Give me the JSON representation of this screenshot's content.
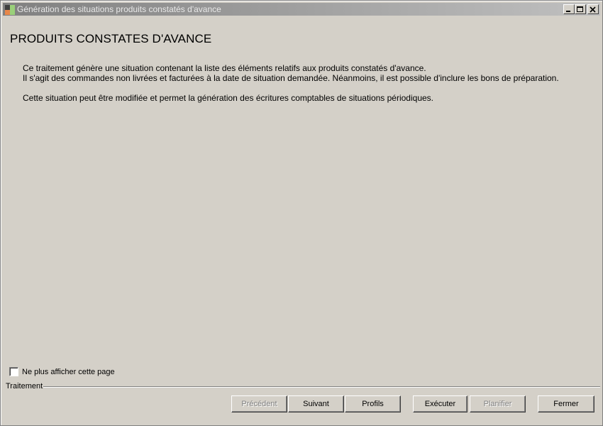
{
  "window": {
    "title": "Génération des situations produits constatés d'avance"
  },
  "page": {
    "title": "PRODUITS CONSTATES D'AVANCE",
    "description": [
      "Ce traitement génère une situation contenant la liste des éléments relatifs aux produits constatés d'avance.",
      "Il s'agit des commandes non livrées et facturées à la date de situation demandée. Néanmoins, il est possible d'inclure les bons de préparation.",
      "Cette situation peut être modifiée et permet la génération des écritures comptables de situations périodiques."
    ]
  },
  "options": {
    "dont_show_label": "Ne plus afficher cette page",
    "dont_show_checked": false
  },
  "group": {
    "label": "Traitement"
  },
  "buttons": {
    "previous": {
      "label": "Précédent",
      "enabled": false
    },
    "next": {
      "label": "Suivant",
      "enabled": true
    },
    "profiles": {
      "label": "Profils",
      "enabled": true
    },
    "execute": {
      "label": "Exécuter",
      "enabled": true
    },
    "schedule": {
      "label": "Planifier",
      "enabled": false
    },
    "close": {
      "label": "Fermer",
      "enabled": true
    }
  }
}
